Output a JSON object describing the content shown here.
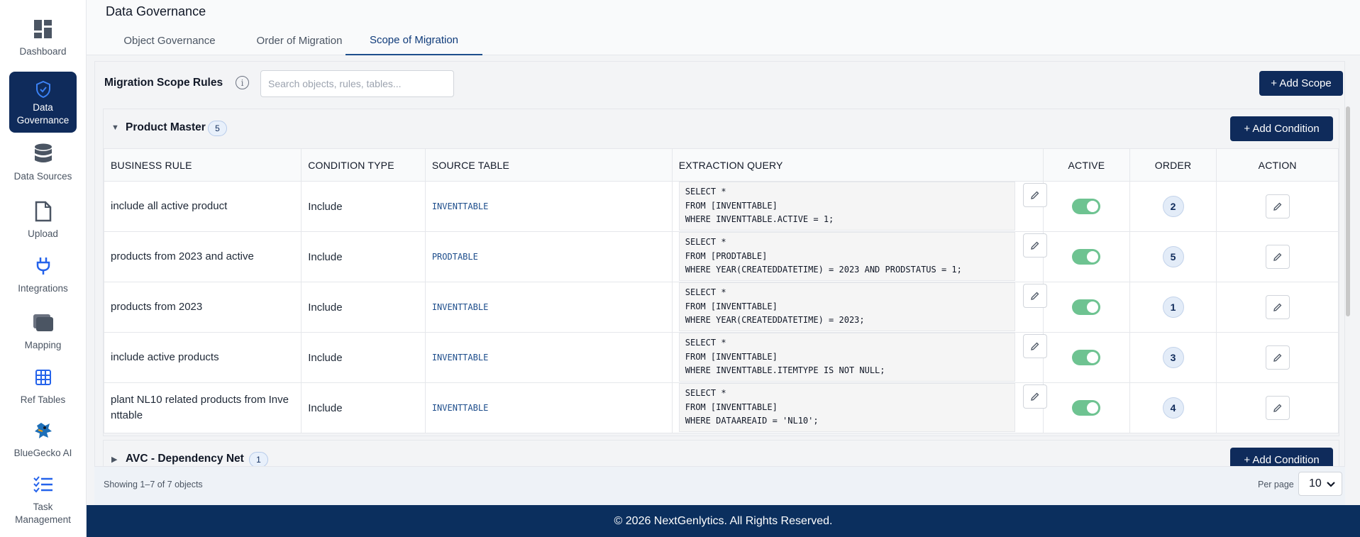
{
  "sidebar": {
    "items": [
      {
        "label": "Dashboard",
        "icon": "dashboard-icon"
      },
      {
        "label": "Data Governance",
        "icon": "shield-check-icon",
        "active": true
      },
      {
        "label": "Data Sources",
        "icon": "database-icon"
      },
      {
        "label": "Upload",
        "icon": "file-icon"
      },
      {
        "label": "Integrations",
        "icon": "plug-icon"
      },
      {
        "label": "Mapping",
        "icon": "folder-icon"
      },
      {
        "label": "Ref Tables",
        "icon": "table-icon"
      },
      {
        "label": "BlueGecko AI",
        "icon": "gecko-icon"
      },
      {
        "label": "Task Management",
        "icon": "checklist-icon"
      }
    ]
  },
  "header": {
    "title": "Data Governance",
    "tabs": [
      {
        "label": "Object Governance"
      },
      {
        "label": "Order of Migration"
      },
      {
        "label": "Scope of Migration",
        "active": true
      }
    ]
  },
  "toolbar": {
    "title": "Migration Scope Rules",
    "search_placeholder": "Search objects, rules, tables...",
    "add_scope_label": "+ Add Scope"
  },
  "groups": [
    {
      "name": "Product Master",
      "count": "5",
      "expanded": true,
      "add_condition_label": "+ Add Condition",
      "columns": [
        "BUSINESS RULE",
        "CONDITION TYPE",
        "SOURCE TABLE",
        "EXTRACTION QUERY",
        "ACTIVE",
        "ORDER",
        "ACTION"
      ],
      "rows": [
        {
          "rule": "include all active product",
          "type": "Include",
          "table": "INVENTTABLE",
          "query": "SELECT *\nFROM [INVENTTABLE]\nWHERE INVENTTABLE.ACTIVE = 1;",
          "active": true,
          "order": "2"
        },
        {
          "rule": "products from 2023 and active",
          "type": "Include",
          "table": "PRODTABLE",
          "query": "SELECT *\nFROM [PRODTABLE]\nWHERE YEAR(CREATEDDATETIME) = 2023 AND PRODSTATUS = 1;",
          "active": true,
          "order": "5"
        },
        {
          "rule": "products from 2023",
          "type": "Include",
          "table": "INVENTTABLE",
          "query": "SELECT *\nFROM [INVENTTABLE]\nWHERE YEAR(CREATEDDATETIME) = 2023;",
          "active": true,
          "order": "1"
        },
        {
          "rule": "include active products",
          "type": "Include",
          "table": "INVENTTABLE",
          "query": "SELECT *\nFROM [INVENTTABLE]\nWHERE INVENTTABLE.ITEMTYPE IS NOT NULL;",
          "active": true,
          "order": "3"
        },
        {
          "rule": "plant NL10 related products from Inve\nnttable",
          "type": "Include",
          "table": "INVENTTABLE",
          "query": "SELECT *\nFROM [INVENTTABLE]\nWHERE DATAAREAID = 'NL10';",
          "active": true,
          "order": "4"
        }
      ]
    },
    {
      "name": "AVC - Dependency Net",
      "count": "1",
      "expanded": false,
      "add_condition_label": "+ Add Condition"
    }
  ],
  "pagination": {
    "showing": "Showing 1–7 of 7 objects",
    "per_page_label": "Per page",
    "per_page_value": "10"
  },
  "footer": {
    "copyright": "© 2026 NextGenlytics. All Rights Reserved."
  },
  "colors": {
    "brand": "#0f2b5b",
    "toggle_on": "#6ec391",
    "footer_bg": "#0b2f5e"
  }
}
